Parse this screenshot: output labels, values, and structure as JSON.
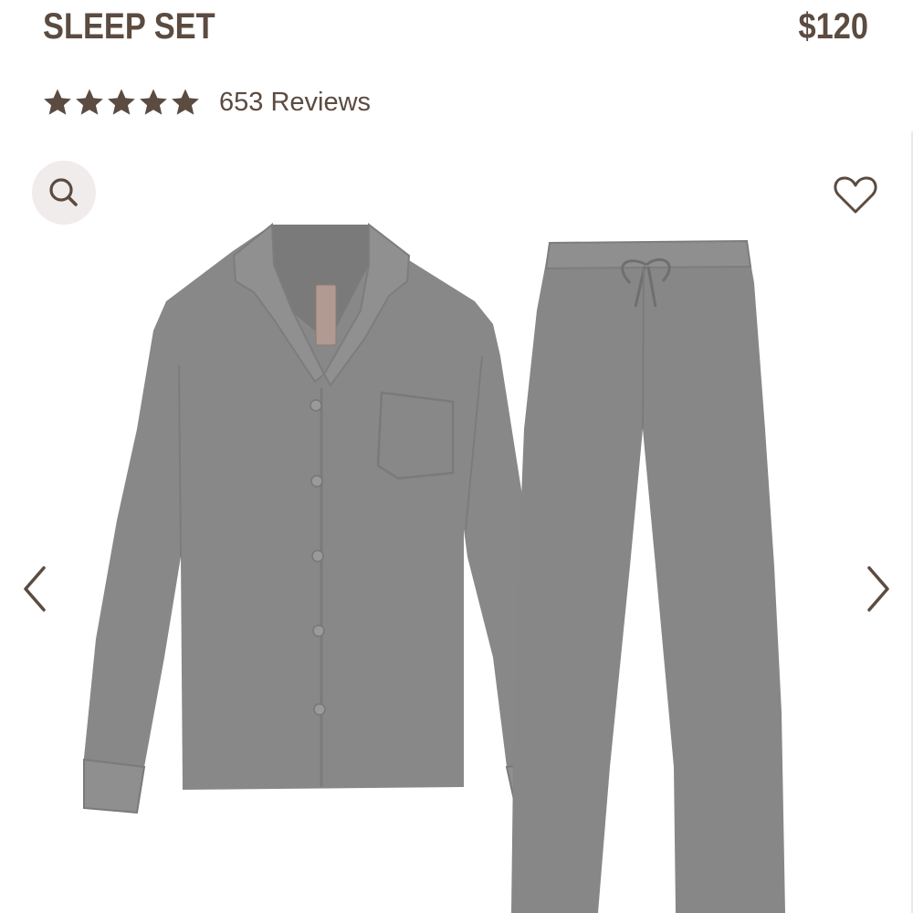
{
  "product": {
    "title": "SLEEP SET",
    "price": "$120",
    "rating_stars": 5,
    "reviews_label": "653 Reviews"
  },
  "gallery": {
    "zoom_icon": "search-icon",
    "wishlist_icon": "heart-icon",
    "prev_icon": "chevron-left-icon",
    "next_icon": "chevron-right-icon",
    "image_subject": "gray-pajama-set"
  },
  "colors": {
    "text_brown": "#5b4b40",
    "zoom_bg": "#efeceb",
    "fabric_gray": "#878787"
  }
}
